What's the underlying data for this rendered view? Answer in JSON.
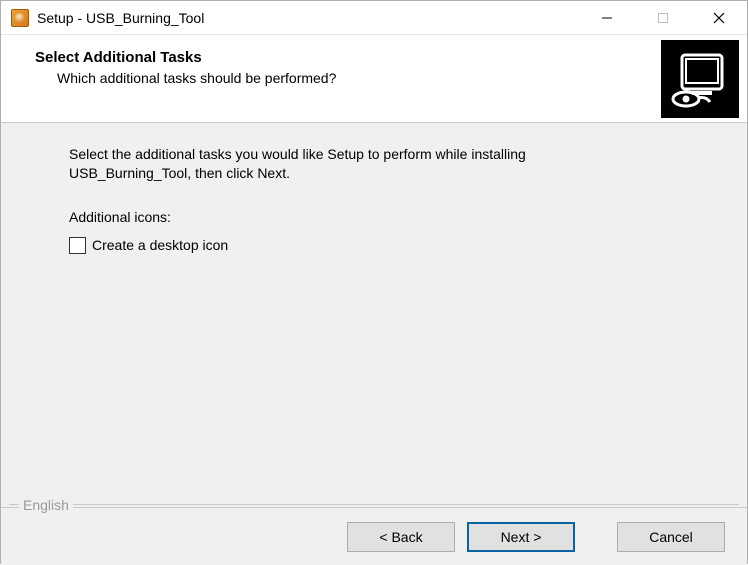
{
  "window": {
    "title": "Setup - USB_Burning_Tool"
  },
  "header": {
    "title": "Select Additional Tasks",
    "subtitle": "Which additional tasks should be performed?"
  },
  "body": {
    "intro": "Select the additional tasks you would like Setup to perform while installing USB_Burning_Tool, then click Next.",
    "group_label": "Additional icons:",
    "checkbox": {
      "label": "Create a desktop icon",
      "checked": false
    }
  },
  "language": {
    "label": "English"
  },
  "footer": {
    "back": "< Back",
    "next": "Next >",
    "cancel": "Cancel"
  }
}
